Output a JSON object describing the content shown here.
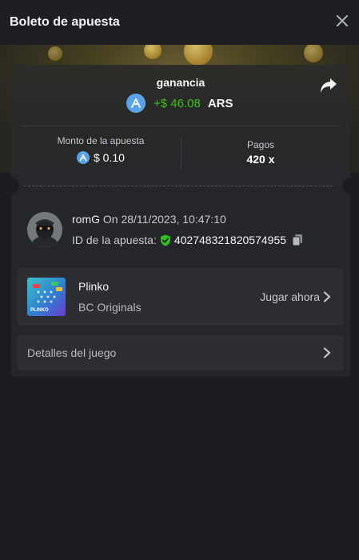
{
  "header": {
    "title": "Boleto de apuesta"
  },
  "profit": {
    "label": "ganancia",
    "value": "+$ 46.08",
    "currency": "ARS"
  },
  "stats": {
    "amount_label": "Monto de la apuesta",
    "amount_value": "$ 0.10",
    "payout_label": "Pagos",
    "payout_value": "420 x"
  },
  "user": {
    "name": "romG",
    "date_text": "On 28/11/2023, 10:47:10",
    "bet_id_label": "ID de la apuesta:",
    "bet_id": "402748321820574955"
  },
  "game": {
    "name": "Plinko",
    "provider": "BC Originals",
    "play_label": "Jugar ahora",
    "thumb_text": "PLINKO"
  },
  "details": {
    "label": "Detalles del juego"
  },
  "colors": {
    "accent_green": "#3bc117",
    "currency_blue": "#5aa3e6",
    "verified_green": "#2ec11f"
  },
  "icons": [
    "close-icon",
    "share-icon",
    "currency-coin-icon",
    "verified-shield-icon",
    "copy-icon",
    "chevron-right-icon"
  ]
}
